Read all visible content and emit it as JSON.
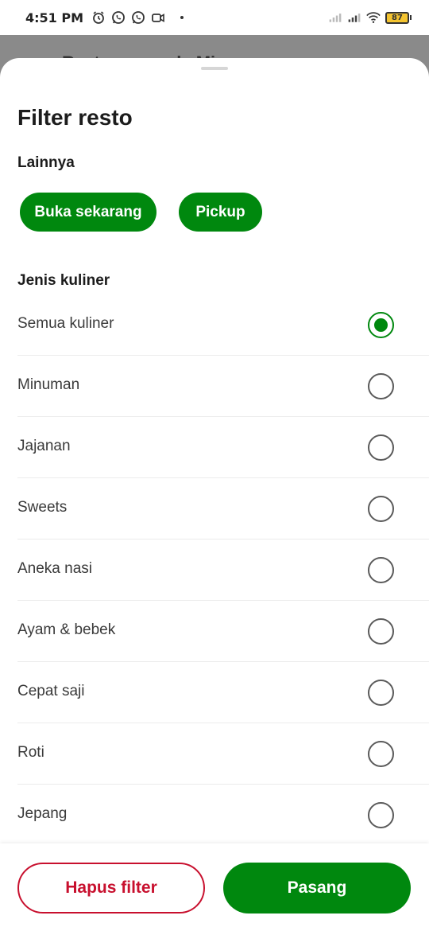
{
  "status_bar": {
    "time": "4:51 PM",
    "battery": "87",
    "icons_left": [
      "alarm-icon",
      "whatsapp-icon",
      "whatsapp-icon",
      "video-icon"
    ],
    "icons_right": [
      "signal-icon",
      "signal-icon",
      "wifi-icon",
      "battery-icon"
    ]
  },
  "backdrop": {
    "title": "Resto yang ada Mie"
  },
  "sheet": {
    "title": "Filter resto",
    "other_section": {
      "label": "Lainnya",
      "chips": [
        "Buka sekarang",
        "Pickup"
      ]
    },
    "cuisine_section": {
      "label": "Jenis kuliner",
      "options": [
        {
          "label": "Semua kuliner",
          "selected": true
        },
        {
          "label": "Minuman",
          "selected": false
        },
        {
          "label": "Jajanan",
          "selected": false
        },
        {
          "label": "Sweets",
          "selected": false
        },
        {
          "label": "Aneka nasi",
          "selected": false
        },
        {
          "label": "Ayam & bebek",
          "selected": false
        },
        {
          "label": "Cepat saji",
          "selected": false
        },
        {
          "label": "Roti",
          "selected": false
        },
        {
          "label": "Jepang",
          "selected": false
        }
      ]
    }
  },
  "footer": {
    "clear_label": "Hapus filter",
    "apply_label": "Pasang"
  },
  "colors": {
    "primary_green": "#00880e",
    "danger_red": "#c8102e"
  }
}
